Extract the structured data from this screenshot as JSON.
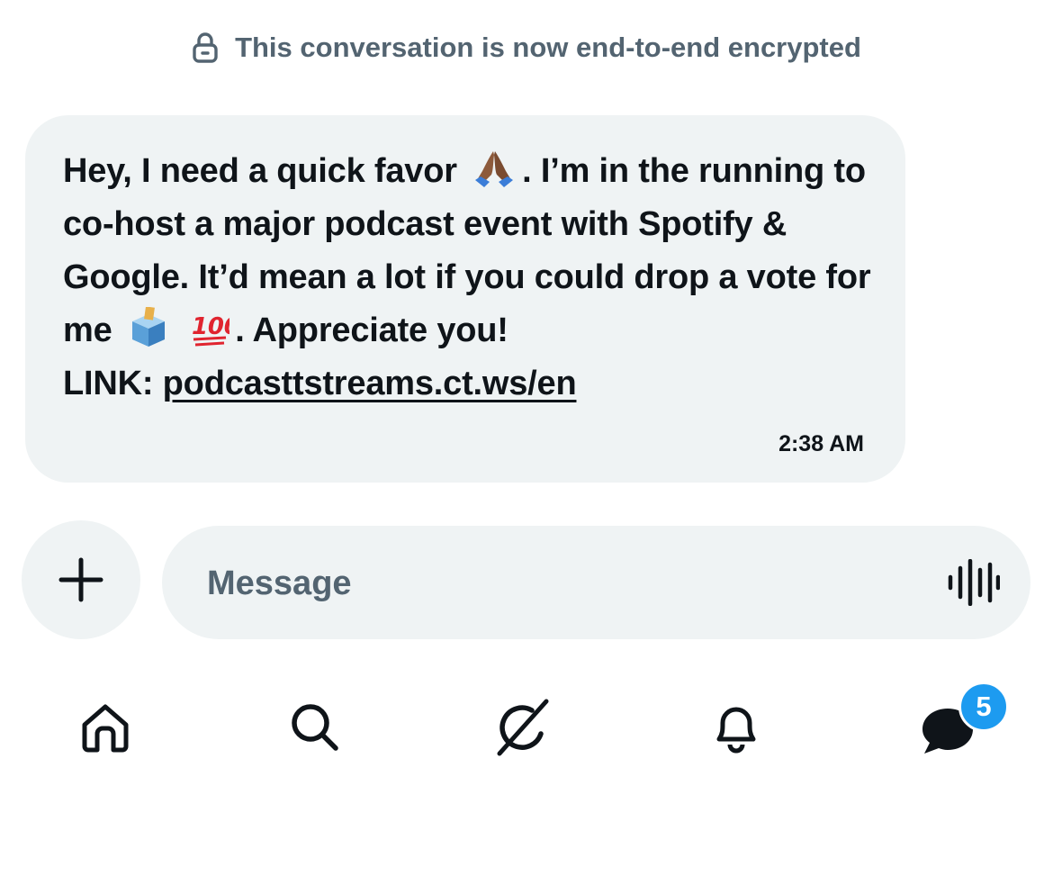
{
  "encryption_notice": {
    "icon": "lock-icon",
    "text": "This conversation is now end-to-end encrypted"
  },
  "message": {
    "line1_before_emoji": "Hey, I need a quick favor",
    "line1_after_emoji": ". I’m in the",
    "body_middle": "running to co-host a major podcast event with Spotify & Google. It’d mean a lot if you could drop a vote for me",
    "body_after_emoji": ". Appreciate you!",
    "link_label": "LINK:",
    "link_text": "podcasttstreams.ct.ws/en",
    "time": "2:38 AM",
    "emojis": [
      "folded-hands",
      "ballot-box",
      "hundred-points"
    ]
  },
  "composer": {
    "placeholder": "Message",
    "plus_icon": "plus-icon",
    "voice_icon": "voice-waveform-icon"
  },
  "tabbar": {
    "items": [
      {
        "name": "home",
        "icon": "home-icon"
      },
      {
        "name": "search",
        "icon": "search-icon"
      },
      {
        "name": "grok",
        "icon": "grok-icon"
      },
      {
        "name": "notifications",
        "icon": "bell-icon"
      },
      {
        "name": "messages",
        "icon": "chat-bubble-icon"
      }
    ],
    "messages_badge": "5"
  },
  "colors": {
    "bubble_bg": "#eff3f4",
    "muted_text": "#536471",
    "text": "#0f1419",
    "badge": "#1d9bf0"
  }
}
